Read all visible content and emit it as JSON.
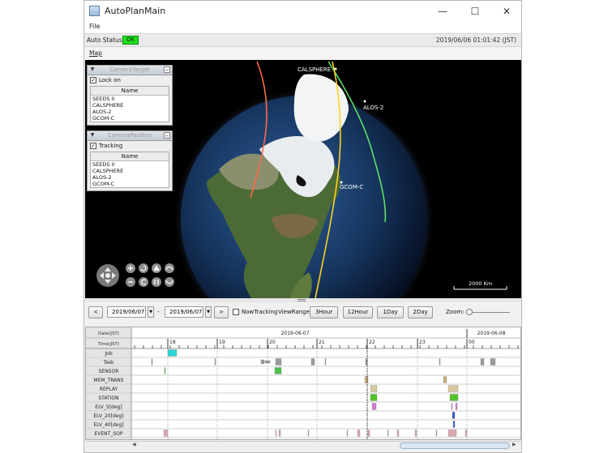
{
  "window": {
    "title": "AutoPlanMain",
    "controls": [
      "—",
      "☐",
      "✕"
    ]
  },
  "menu": {
    "file": "File"
  },
  "status": {
    "label": "Auto Status:",
    "badge": "OK",
    "badge_color": "#1ee21e",
    "datetime": "2019/06/06 01:01:42 (JST)"
  },
  "map_tab": "Map",
  "globe": {
    "satellites": [
      "CALSPHERE",
      "ALOS-2",
      "GCOM-C"
    ],
    "scale_label": "2000 Km",
    "nav_icons": [
      "pan-icon",
      "zoom-in-icon",
      "rotate-icon",
      "tilt-up-icon",
      "heading-icon",
      "zoom-out-icon",
      "reset-icon",
      "pause-icon",
      "tilt-down-icon"
    ]
  },
  "camera_target": {
    "title": "CameraTarget",
    "checkbox_label": "Lock on",
    "checked": true,
    "column": "Name",
    "rows": [
      "SEEDS II",
      "CALSPHERE",
      "ALOS-2",
      "GCOM-C"
    ]
  },
  "camera_position": {
    "title": "CameraPosition",
    "checkbox_label": "Tracking",
    "checked": true,
    "column": "Name",
    "rows": [
      "SEEDS II",
      "CALSPHERE",
      "ALOS-2",
      "GCOM-C"
    ]
  },
  "controls": {
    "prev": "<",
    "next": ">",
    "date_from": "2019/06/07",
    "date_to": "2019/06/07",
    "separator": "-",
    "now_tracking": "NowTracking",
    "view_range": "ViewRange:",
    "ranges": [
      "3Hour",
      "12Hour",
      "1Day",
      "2Day"
    ],
    "zoom_label": "Zoom:"
  },
  "timeline": {
    "date_header": "Date(JST)",
    "time_header": "Time(JST)",
    "dates": [
      "2019-06-07",
      "2019-06-08"
    ],
    "hours": [
      "18",
      "19",
      "20",
      "21",
      "22",
      "23",
      "00"
    ],
    "rows": [
      "Job",
      "Task",
      "SENSOR",
      "MEM_TRANS",
      "REPLAY",
      "STATION",
      "ELV_5[deg]",
      "ELV_20[deg]",
      "ELV_40[deg]",
      "EVENT_SOP"
    ],
    "colors": {
      "job": "#2ed3d3",
      "sensor": "#4dbf4d",
      "mem_trans": "#c8b27a",
      "replay": "#d8c8a0",
      "station": "#55c22a",
      "elv5": "#d278d2",
      "elv20": "#3a5ad2",
      "event": "#d8a8b0",
      "task": "#9a9a9a"
    }
  }
}
